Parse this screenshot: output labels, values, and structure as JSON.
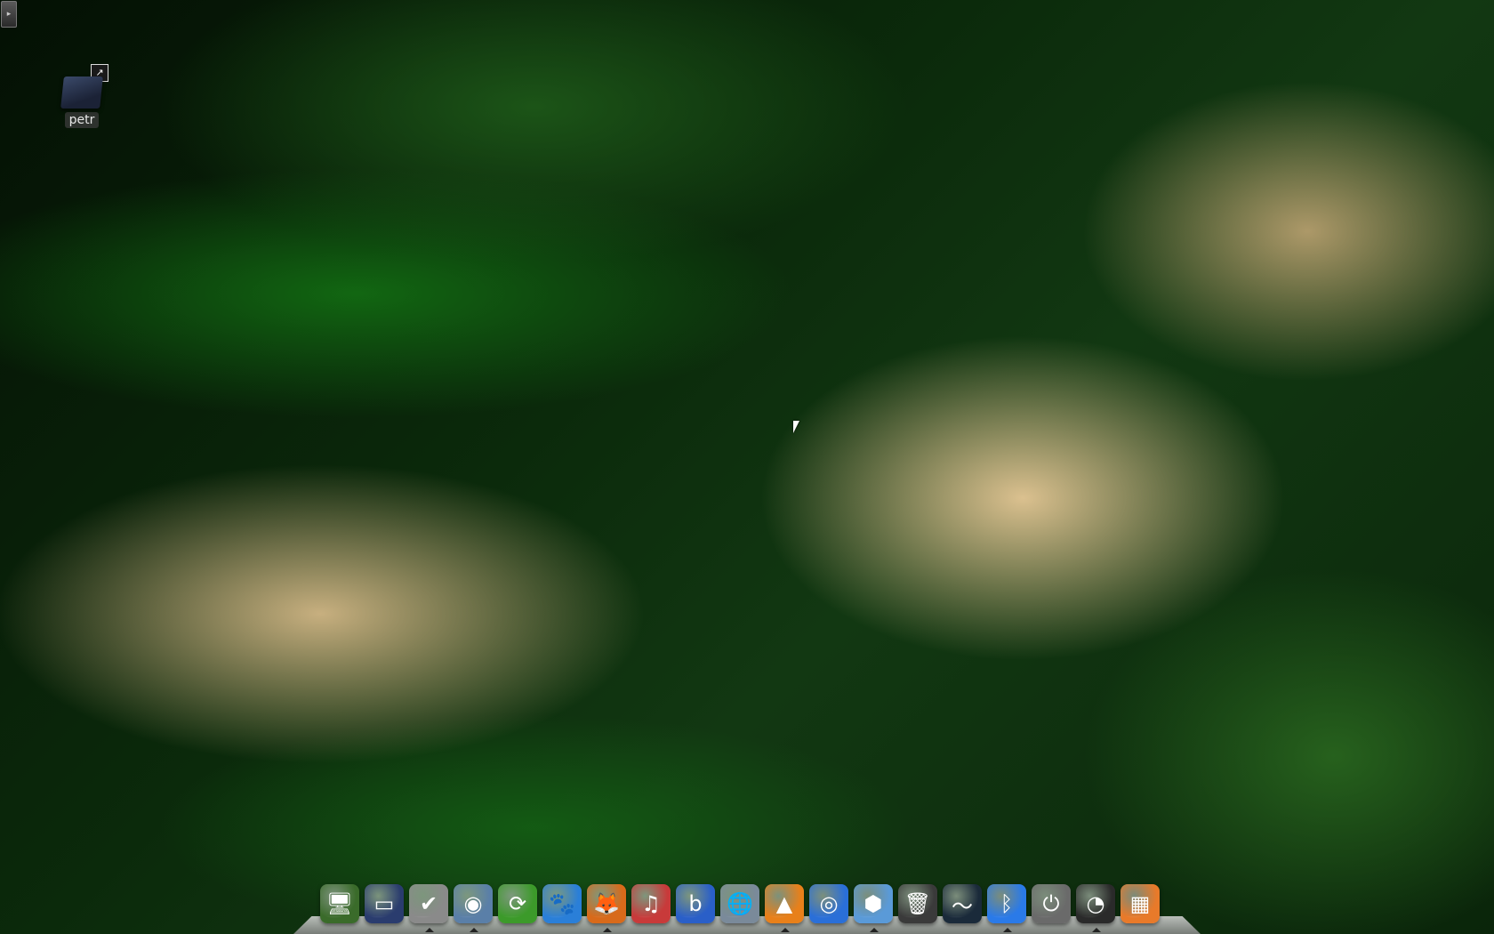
{
  "edge_handle": {
    "glyph": "▸"
  },
  "desktop_icons": [
    {
      "label": "petr",
      "badge": "↗",
      "icon": "folder-shortcut-icon"
    }
  ],
  "dock": {
    "items": [
      {
        "name": "display-settings-icon",
        "glyph": "🖥",
        "color": "#3a6b2a"
      },
      {
        "name": "terminal-icon",
        "glyph": "▭",
        "color": "#2a3c6e"
      },
      {
        "name": "disk-utility-icon",
        "glyph": "✔",
        "color": "#8a8a8a"
      },
      {
        "name": "chrome-icon",
        "glyph": "◉",
        "color": "#5a7fa8"
      },
      {
        "name": "update-manager-icon",
        "glyph": "⟳",
        "color": "#3c9a2a"
      },
      {
        "name": "gnome-icon",
        "glyph": "🐾",
        "color": "#2a7fd8"
      },
      {
        "name": "firefox-icon",
        "glyph": "🦊",
        "color": "#d86a1a"
      },
      {
        "name": "media-player-icon",
        "glyph": "♫",
        "color": "#c83a3a"
      },
      {
        "name": "bittorrent-icon",
        "glyph": "b",
        "color": "#2a5fc8"
      },
      {
        "name": "network-globe-icon",
        "glyph": "🌐",
        "color": "#7a8a9a"
      },
      {
        "name": "vlc-icon",
        "glyph": "▲",
        "color": "#e8801a"
      },
      {
        "name": "web-browser-icon",
        "glyph": "◎",
        "color": "#2a6fd8"
      },
      {
        "name": "virtualbox-icon",
        "glyph": "⬢",
        "color": "#5a9ad8"
      },
      {
        "name": "trash-icon",
        "glyph": "🗑",
        "color": "#3a3a3a"
      },
      {
        "name": "system-monitor-icon",
        "glyph": "〜",
        "color": "#1a2a3a"
      },
      {
        "name": "bluetooth-icon",
        "glyph": "ᛒ",
        "color": "#2a7ae8"
      },
      {
        "name": "power-icon",
        "glyph": "⏻",
        "color": "#6a6a6a"
      },
      {
        "name": "clock-icon",
        "glyph": "◔",
        "color": "#2a2a2a"
      },
      {
        "name": "image-viewer-icon",
        "glyph": "▦",
        "color": "#e87a2a"
      }
    ],
    "running": [
      2,
      3,
      6,
      10,
      12,
      15,
      17
    ]
  }
}
